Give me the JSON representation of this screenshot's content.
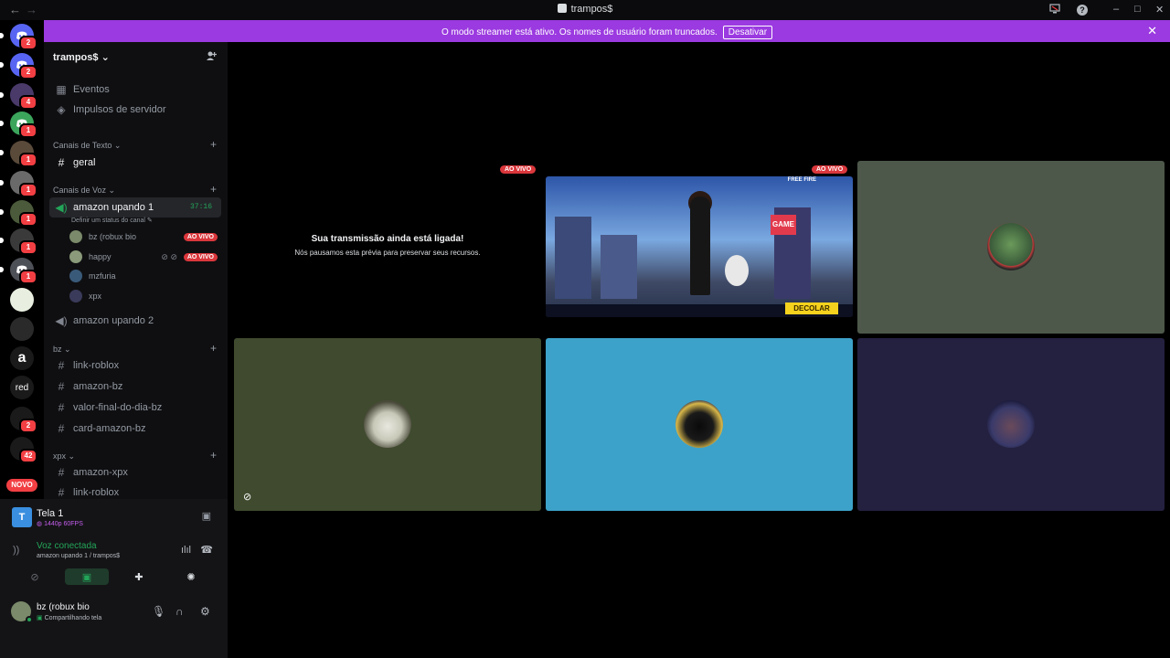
{
  "titlebar": {
    "back": "←",
    "forward": "→",
    "title": "trampos$",
    "inbox_icon": "monitor-icon",
    "help": "?",
    "minimize": "–",
    "maximize": "□",
    "close": "✕"
  },
  "banner": {
    "message": "O modo streamer está ativo. Os nomes de usuário foram truncados.",
    "button": "Desativar",
    "close": "✕"
  },
  "rail": {
    "servers": [
      {
        "kind": "discord",
        "badge": "2",
        "color": "#5865f2"
      },
      {
        "kind": "discord",
        "badge": "2",
        "color": "#5865f2"
      },
      {
        "kind": "avatar",
        "badge": "4",
        "color": "#4a3a6a"
      },
      {
        "kind": "discord",
        "badge": "1",
        "color": "#3ba55c"
      },
      {
        "kind": "avatar",
        "badge": "1",
        "color": "#5a4a3a"
      },
      {
        "kind": "avatar",
        "badge": "1",
        "color": "#6a6a6a"
      },
      {
        "kind": "avatar",
        "badge": "1",
        "color": "#4a5a3a"
      },
      {
        "kind": "avatar",
        "badge": "1",
        "color": "#3a3a3a"
      },
      {
        "kind": "discord",
        "badge": "1",
        "color": "#4e5058"
      },
      {
        "kind": "avatar",
        "badge": "",
        "color": "#e8efe0"
      },
      {
        "kind": "avatar",
        "badge": "",
        "color": "#2a2a2a"
      },
      {
        "kind": "amazon",
        "badge": "",
        "color": "#1a1a1a",
        "label": "a"
      },
      {
        "kind": "text",
        "badge": "",
        "color": "#1a1a1a",
        "label": "red"
      },
      {
        "kind": "folder",
        "badge": "2",
        "color": "#1a1a1a"
      },
      {
        "kind": "folder",
        "badge": "42",
        "color": "#1a1a1a"
      }
    ],
    "novo_label": "NOVO"
  },
  "sidebar": {
    "server_name": "trampos$",
    "shortcuts": [
      {
        "label": "Eventos",
        "icon": "calendar-icon"
      },
      {
        "label": "Impulsos de servidor",
        "icon": "boost-icon"
      }
    ],
    "text_category": "Canais de Texto",
    "text_channels": [
      {
        "label": "geral"
      }
    ],
    "voice_category": "Canais de Voz",
    "voice_channel_1": {
      "label": "amazon upando 1",
      "status": "Definir um status do canal",
      "timer": "37:16"
    },
    "voice_members": [
      {
        "name": "bz (robux bio",
        "live": "AO VIVO",
        "color": "#7a8a6a"
      },
      {
        "name": "happy",
        "live": "AO VIVO",
        "color": "#8a9a7a"
      },
      {
        "name": "mzfuria",
        "live": "",
        "color": "#3a5a7a"
      },
      {
        "name": "xpx",
        "live": "",
        "color": "#3a3a5a"
      }
    ],
    "voice_channel_2": {
      "label": "amazon upando 2"
    },
    "bz_category": "bz",
    "bz_channels": [
      {
        "label": "link-roblox"
      },
      {
        "label": "amazon-bz"
      },
      {
        "label": "valor-final-do-dia-bz"
      },
      {
        "label": "card-amazon-bz"
      }
    ],
    "xpx_category": "xpx",
    "xpx_channels": [
      {
        "label": "amazon-xpx"
      },
      {
        "label": "link-roblox"
      }
    ]
  },
  "panel": {
    "stream": {
      "title": "Tela 1",
      "quality": "1440p 60FPS"
    },
    "voice": {
      "status": "Voz conectada",
      "channel": "amazon upando 1 / trampos$"
    },
    "user": {
      "name": "bz (robux bio",
      "status": "Compartilhando tela"
    }
  },
  "main": {
    "paused_title": "Sua transmissão ainda está ligada!",
    "paused_text": "Nós pausamos esta prévia para preservar seus recursos.",
    "live_tag_1": "AO VIVO",
    "live_tag_2": "AO VIVO",
    "game": {
      "title": "FREE FIRE",
      "button": "DECOLAR",
      "sign": "GAME"
    },
    "tiles": [
      {
        "bg": "#4d584a"
      },
      {
        "bg": "#3f4a2e"
      },
      {
        "bg": "#3da2c9"
      },
      {
        "bg": "#242040"
      }
    ]
  }
}
